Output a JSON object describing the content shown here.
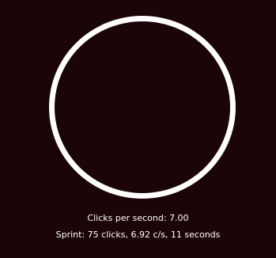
{
  "colors": {
    "background": "#1c0506",
    "ring": "#ffffff",
    "text": "#ffffff"
  },
  "stats": {
    "cps_text": "Clicks per second: 7.00",
    "sprint_text": "Sprint: 75 clicks, 6.92 c/s, 11 seconds"
  }
}
